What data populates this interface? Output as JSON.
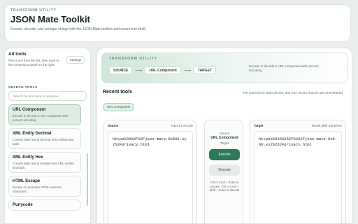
{
  "header": {
    "eyebrow": "TRANSFORM UTILITY",
    "title": "JSON Mate Toolkit",
    "subtitle": "Encode, decode, and reshape strings with the JSON Mate toolbox and recent tool shelf."
  },
  "sidebar": {
    "heading": "All tools",
    "description": "Pick a tool from the list, then work in the conversion panel on the right.",
    "settings_label": "Settings",
    "search_label": "SEARCH TOOLS",
    "search_placeholder": "Search by tool name or purpose",
    "tools": [
      {
        "name": "URL Component",
        "desc": "Encode or decode a URL component with percent-encoding.",
        "active": true
      },
      {
        "name": "XML Entity Decimal",
        "desc": "Convert plain text to decimal XML entities and back.",
        "active": false
      },
      {
        "name": "XML Entity Hex",
        "desc": "Convert plain text to hexadecimal XML entities and back.",
        "active": false
      },
      {
        "name": "HTML Escape",
        "desc": "Escape or unescape HTML-sensitive characters.",
        "active": false
      },
      {
        "name": "Punycode",
        "desc": "",
        "active": false
      }
    ]
  },
  "main": {
    "hero": {
      "eyebrow": "TRANSFORM UTILITY",
      "source": "SOURCE",
      "component": "URL Component",
      "target": "TARGET",
      "description": "Encode or decode a URL component with percent-encoding."
    },
    "recent": {
      "heading": "Recent tools",
      "note": "The current tool stays pinned, and your recent choices are remembered.",
      "chips": [
        "URL Component"
      ]
    },
    "source_panel": {
      "label": "Source",
      "hint": "Input to encode",
      "value": "https%3A%2F%2Fjson-mate.0o666.xyz%2Fprivacy.html"
    },
    "middle": {
      "source_label": "Source",
      "tool_name": "URL Component",
      "target_label": "Target",
      "encode_label": "Encode",
      "decode_label": "Decode",
      "hint": "Ctrl or Cmd + Enter to encode. Ctrl or Cmd + Shift + Enter to decode"
    },
    "target_panel": {
      "label": "Target",
      "hint": "Result after transform",
      "value": "https%253A%252F%252Fjson-mate.0o666.xyz%252Fprivacy.html"
    }
  },
  "colors": {
    "accent": "#2c7a5b",
    "accent_soft": "#dfeee5",
    "background": "#e9eeea"
  }
}
